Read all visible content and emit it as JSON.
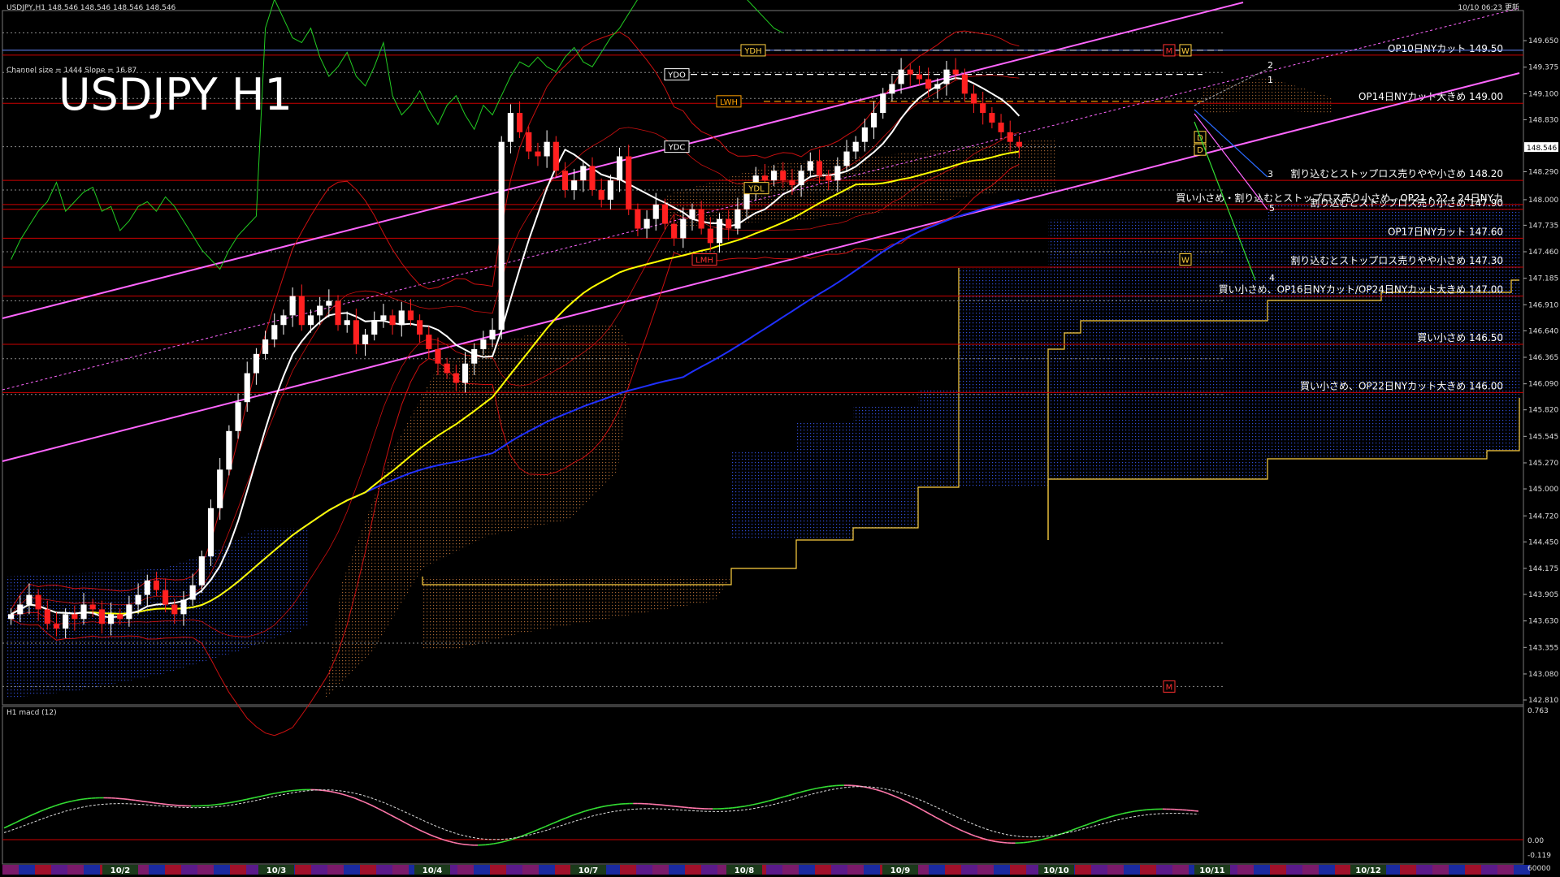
{
  "header": {
    "symbol_info": "USDJPY,H1  148.546 148.546 148.546 148.546",
    "update_time": "10/10 06:23 更新",
    "channel_info": "Channel size = 1444 Slope = 16.87",
    "big_title": "USDJPY H1"
  },
  "macd": {
    "label": "H1  macd (12)",
    "scale_top": "0.763",
    "scale_zero": "0.00",
    "scale_bottom": "-0.119",
    "scale_extra": "60000"
  },
  "current_price": "148.546",
  "colors": {
    "bg": "#000000",
    "bull": "#ffffff",
    "bear": "#ff2020",
    "ma_white": "#ffffff",
    "ma_yellow": "#ffff00",
    "ma_blue": "#2030ff",
    "channel": "#ff66ff",
    "kijun": "#ffd040",
    "bollinger": "#cc1010",
    "chikou": "#22cc22",
    "macd": "#33dd33",
    "macd_neg": "#ff77aa",
    "level_red": "#cc0000",
    "grid_dot": "#888888"
  },
  "chart_data": {
    "type": "candlestick",
    "title": "USDJPY H1",
    "ylim": [
      142.81,
      149.92
    ],
    "y_ticks": [
      "149.650",
      "149.375",
      "149.100",
      "148.830",
      "148.290",
      "148.000",
      "147.735",
      "147.460",
      "147.185",
      "146.910",
      "146.640",
      "146.365",
      "146.090",
      "145.820",
      "145.545",
      "145.270",
      "145.000",
      "144.720",
      "144.450",
      "144.175",
      "143.905",
      "143.630",
      "143.355",
      "143.080",
      "142.810"
    ],
    "x_labels": [
      "10/2",
      "10/3",
      "10/4",
      "10/7",
      "10/8",
      "10/9",
      "10/10",
      "10/11",
      "10/12"
    ],
    "close_series": [
      143.7,
      143.8,
      143.9,
      143.75,
      143.6,
      143.55,
      143.7,
      143.65,
      143.8,
      143.75,
      143.6,
      143.7,
      143.65,
      143.8,
      143.9,
      144.05,
      143.95,
      143.8,
      143.7,
      143.85,
      144.0,
      144.3,
      144.8,
      145.2,
      145.6,
      145.9,
      146.2,
      146.4,
      146.55,
      146.7,
      146.8,
      147.0,
      146.7,
      146.8,
      146.9,
      146.95,
      146.7,
      146.75,
      146.5,
      146.6,
      146.75,
      146.8,
      146.7,
      146.85,
      146.75,
      146.6,
      146.45,
      146.3,
      146.2,
      146.1,
      146.3,
      146.45,
      146.55,
      146.65,
      148.6,
      148.9,
      148.7,
      148.5,
      148.45,
      148.6,
      148.3,
      148.1,
      148.2,
      148.35,
      148.1,
      148.0,
      148.2,
      148.45,
      147.9,
      147.7,
      147.8,
      147.95,
      147.75,
      147.6,
      147.8,
      147.9,
      147.7,
      147.55,
      147.8,
      147.7,
      147.9,
      148.1,
      148.25,
      148.2,
      148.3,
      148.2,
      148.15,
      148.3,
      148.4,
      148.25,
      148.2,
      148.35,
      148.5,
      148.6,
      148.75,
      148.9,
      149.1,
      149.2,
      149.35,
      149.3,
      149.25,
      149.15,
      149.2,
      149.35,
      149.3,
      149.1,
      149.0,
      148.9,
      148.8,
      148.7,
      148.6,
      148.55
    ],
    "levels": [
      {
        "price": 149.5,
        "label": "OP10日NYカット 149.50"
      },
      {
        "price": 149.0,
        "label": "OP14日NYカット大きめ 149.00"
      },
      {
        "price": 148.2,
        "label": "割り込むとストップロス売りやや小さめ 148.20"
      },
      {
        "price": 147.95,
        "label": "買い小さめ・割り込むとストップロス売り小さめ、OP21・22・24日NYカ"
      },
      {
        "price": 147.9,
        "label": "割り込むとストップロス売り小さめ 147.90"
      },
      {
        "price": 147.6,
        "label": "OP17日NYカット 147.60"
      },
      {
        "price": 147.3,
        "label": "割り込むとストップロス売りやや小さめ 147.30"
      },
      {
        "price": 147.0,
        "label": "買い小さめ、OP16日NYカット/OP24日NYカット大きめ 147.00"
      },
      {
        "price": 146.5,
        "label": "買い小さめ 146.50"
      },
      {
        "price": 146.0,
        "label": "買い小さめ、OP22日NYカット大きめ 146.00"
      }
    ],
    "markers": [
      {
        "text": "YDH",
        "price": 149.55
      },
      {
        "text": "YDO",
        "price": 149.3
      },
      {
        "text": "LWH",
        "price": 149.02
      },
      {
        "text": "YDC",
        "price": 148.55
      },
      {
        "text": "YDL",
        "price": 148.12
      },
      {
        "text": "LMH",
        "price": 147.38
      },
      {
        "text": "M",
        "price": 149.55
      },
      {
        "text": "W",
        "price": 149.55
      },
      {
        "text": "W",
        "price": 147.38
      },
      {
        "text": "M",
        "price": 142.95
      },
      {
        "text": "D",
        "price": 148.65
      },
      {
        "text": "D",
        "price": 148.52
      }
    ],
    "forecast_labels": [
      "2",
      "1",
      "3",
      "5",
      "4"
    ]
  }
}
